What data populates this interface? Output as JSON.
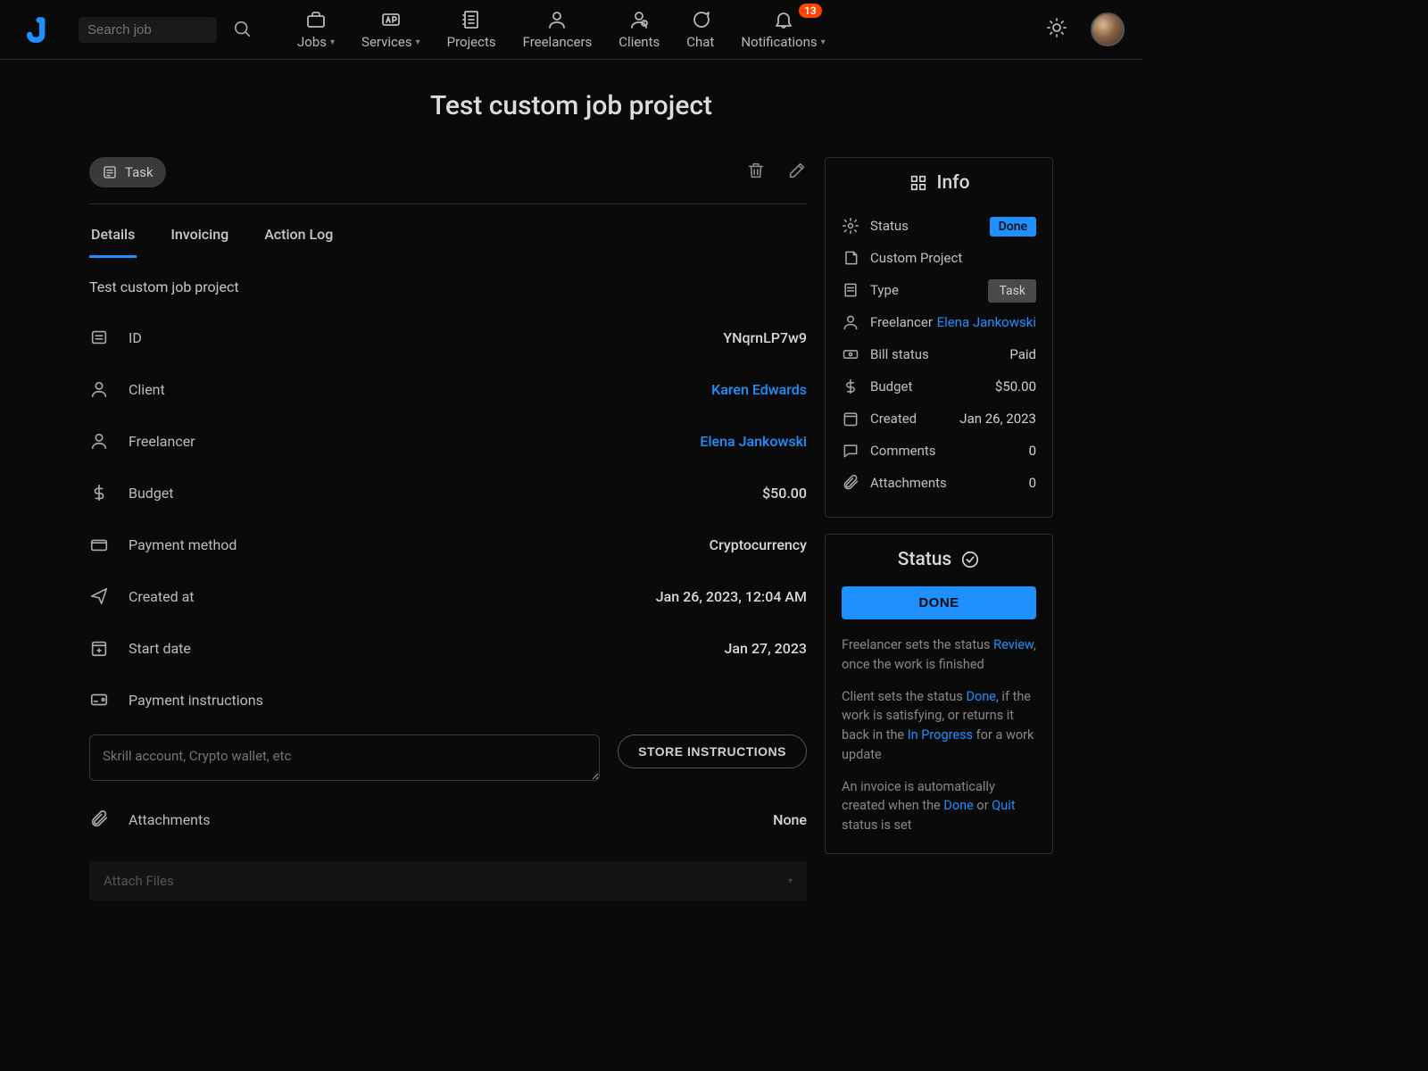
{
  "header": {
    "search_placeholder": "Search job",
    "nav": {
      "jobs": "Jobs",
      "services": "Services",
      "projects": "Projects",
      "freelancers": "Freelancers",
      "clients": "Clients",
      "chat": "Chat",
      "notifications": "Notifications",
      "notifications_badge": "13"
    }
  },
  "page": {
    "title": "Test custom job project"
  },
  "main": {
    "task_label": "Task",
    "tabs": {
      "details": "Details",
      "invoicing": "Invoicing",
      "actionlog": "Action Log"
    },
    "project_name": "Test custom job project",
    "rows": {
      "id": {
        "label": "ID",
        "value": "YNqrnLP7w9"
      },
      "client": {
        "label": "Client",
        "value": "Karen Edwards"
      },
      "freelancer": {
        "label": "Freelancer",
        "value": "Elena Jankowski"
      },
      "budget": {
        "label": "Budget",
        "value": "$50.00"
      },
      "payment_method": {
        "label": "Payment method",
        "value": "Cryptocurrency"
      },
      "created_at": {
        "label": "Created at",
        "value": "Jan 26, 2023, 12:04 AM"
      },
      "start_date": {
        "label": "Start date",
        "value": "Jan 27, 2023"
      },
      "payment_instructions": {
        "label": "Payment instructions"
      },
      "attachments": {
        "label": "Attachments",
        "value": "None"
      }
    },
    "instructions_placeholder": "Skrill account, Crypto wallet, etc",
    "store_button": "STORE INSTRUCTIONS",
    "attach_placeholder": "Attach Files"
  },
  "info": {
    "title": "Info",
    "status": {
      "label": "Status",
      "value": "Done"
    },
    "custom_project": "Custom Project",
    "type": {
      "label": "Type",
      "value": "Task"
    },
    "freelancer": {
      "label": "Freelancer",
      "value": "Elena Jankowski"
    },
    "bill_status": {
      "label": "Bill status",
      "value": "Paid"
    },
    "budget": {
      "label": "Budget",
      "value": "$50.00"
    },
    "created": {
      "label": "Created",
      "value": "Jan 26, 2023"
    },
    "comments": {
      "label": "Comments",
      "value": "0"
    },
    "attachments": {
      "label": "Attachments",
      "value": "0"
    }
  },
  "status_panel": {
    "title": "Status",
    "button": "DONE",
    "p1a": "Freelancer sets the status ",
    "p1_hl": "Review",
    "p1b": ", once the work is finished",
    "p2a": "Client sets the status ",
    "p2_hl1": "Done",
    "p2b": ", if the work is satisfying, or returns it back in the ",
    "p2_hl2": "In Progress",
    "p2c": " for a work update",
    "p3a": "An invoice is automatically created when the ",
    "p3_hl1": "Done",
    "p3b": " or ",
    "p3_hl2": "Quit",
    "p3c": " status is set"
  }
}
